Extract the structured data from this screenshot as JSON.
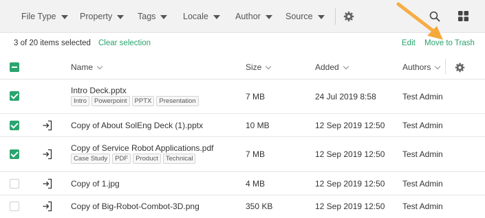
{
  "filters": [
    {
      "label": "File Type"
    },
    {
      "label": "Property"
    },
    {
      "label": "Tags"
    },
    {
      "label": "Locale"
    },
    {
      "label": "Author"
    },
    {
      "label": "Source"
    }
  ],
  "selection": {
    "count_text": "3 of 20 items selected",
    "clear_label": "Clear selection"
  },
  "actions": {
    "edit_label": "Edit",
    "trash_label": "Move to Trash"
  },
  "columns": {
    "name": "Name",
    "size": "Size",
    "added": "Added",
    "authors": "Authors"
  },
  "rows": [
    {
      "name": "Intro Deck.pptx",
      "size": "7 MB",
      "added": "24 Jul 2019 8:58",
      "author": "Test Admin",
      "checked": true,
      "tags": [
        "Intro",
        "Powerpoint",
        "PPTX",
        "Presentation"
      ]
    },
    {
      "name": "Copy of About SolEng Deck (1).pptx",
      "size": "10 MB",
      "added": "12 Sep 2019 12:50",
      "author": "Test Admin",
      "checked": true,
      "tags": []
    },
    {
      "name": "Copy of Service Robot Applications.pdf",
      "size": "7 MB",
      "added": "12 Sep 2019 12:50",
      "author": "Test Admin",
      "checked": true,
      "tags": [
        "Case Study",
        "PDF",
        "Product",
        "Technical"
      ]
    },
    {
      "name": "Copy of 1.jpg",
      "size": "4 MB",
      "added": "12 Sep 2019 12:50",
      "author": "Test Admin",
      "checked": false,
      "tags": []
    },
    {
      "name": "Copy of Big-Robot-Combot-3D.png",
      "size": "350 KB",
      "added": "12 Sep 2019 12:50",
      "author": "Test Admin",
      "checked": false,
      "tags": []
    }
  ],
  "colors": {
    "accent": "#2aa56f",
    "link": "#27a36b",
    "annotation_arrow": "#f5a93a"
  },
  "icons": [
    "settings-gear-icon",
    "search-icon",
    "grid-view-icon",
    "open-file-icon",
    "chevron-down-icon"
  ]
}
